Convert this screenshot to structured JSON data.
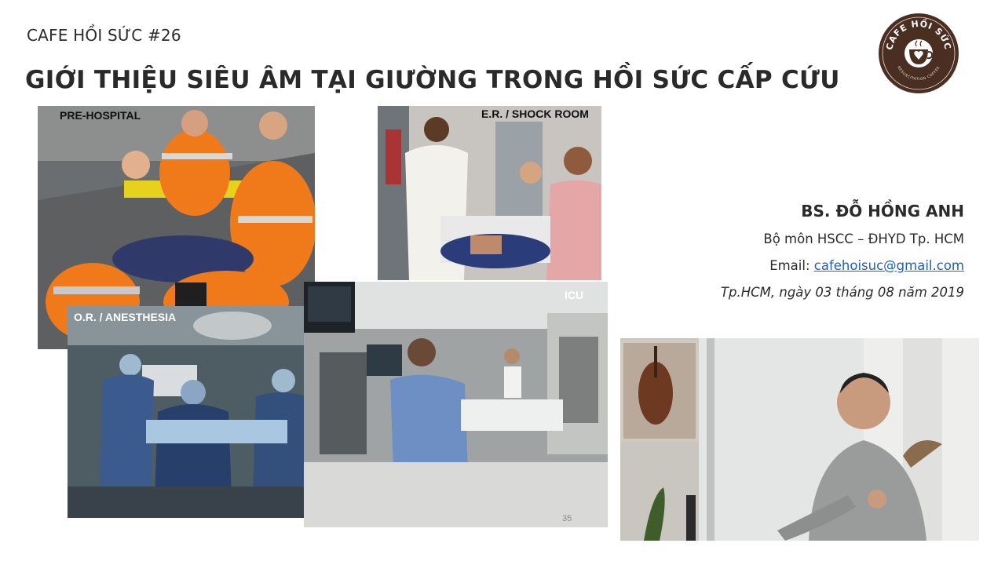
{
  "slide": {
    "series_label": "CAFE HỒI SỨC #26",
    "title": "GIỚI THIỆU SIÊU ÂM TẠI GIƯỜNG TRONG HỒI SỨC CẤP CỨU",
    "slide_number": "35"
  },
  "logo": {
    "text_top": "CAFE HỒI SỨC",
    "text_bottom": "RESUSCITATION COFFEE"
  },
  "photos": [
    {
      "label": "PRE-HOSPITAL"
    },
    {
      "label": "E.R. / SHOCK ROOM"
    },
    {
      "label": "O.R. / ANESTHESIA"
    },
    {
      "label": "ICU"
    }
  ],
  "speaker": {
    "name": "BS. ĐỖ HỒNG ANH",
    "department": "Bộ môn HSCC – ĐHYD Tp.  HCM",
    "email_label": "Email: ",
    "email": "cafehoisuc@gmail.com",
    "date": "Tp.HCM, ngày 03 tháng 08 năm 2019"
  },
  "colors": {
    "logo_brown": "#4a2e22",
    "email_blue": "#1f5fbf",
    "title_text": "#2a2a2a"
  }
}
